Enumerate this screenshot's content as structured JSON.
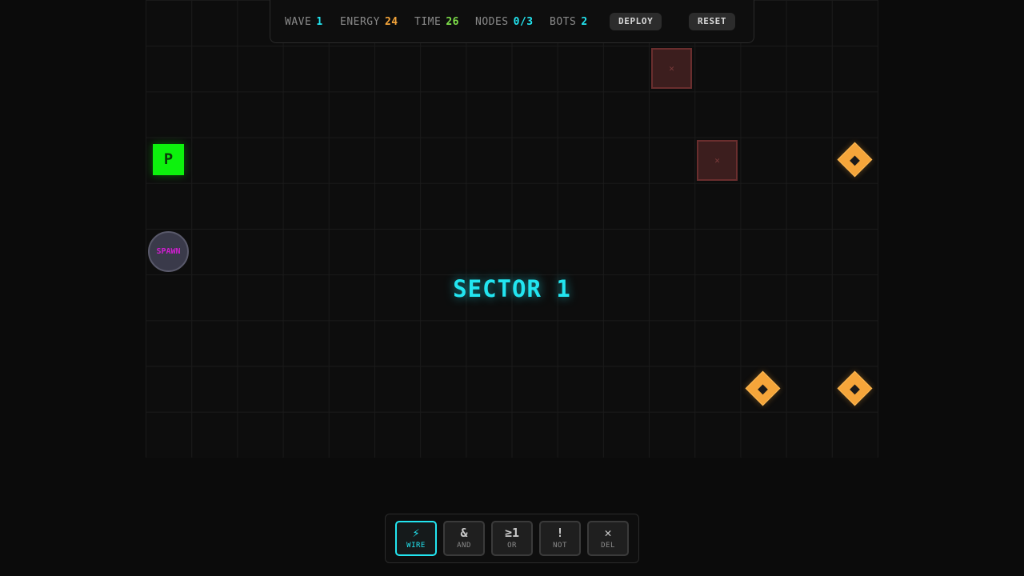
{
  "hud": {
    "wave": {
      "label": "WAVE",
      "value": "1",
      "color": "#22e5f0"
    },
    "energy": {
      "label": "ENERGY",
      "value": "24",
      "color": "#f5a53a"
    },
    "time": {
      "label": "TIME",
      "value": "26",
      "color": "#7ee04a"
    },
    "nodes": {
      "label": "NODES",
      "value": "0/3",
      "color": "#22e5f0"
    },
    "bots": {
      "label": "BOTS",
      "value": "2",
      "color": "#22e5f0"
    },
    "deploy_label": "DEPLOY",
    "reset_label": "RESET"
  },
  "board": {
    "player_label": "P",
    "spawn_label": "SPAWN",
    "blocked_mark": "✕",
    "banner": "SECTOR 1"
  },
  "toolbar": {
    "tools": [
      {
        "icon": "bolt-icon",
        "glyph": "⚡",
        "label": "WIRE",
        "active": true
      },
      {
        "icon": "ampersand-icon",
        "glyph": "&",
        "label": "AND",
        "active": false
      },
      {
        "icon": "ge-one-icon",
        "glyph": "≥1",
        "label": "OR",
        "active": false
      },
      {
        "icon": "exclamation-icon",
        "glyph": "!",
        "label": "NOT",
        "active": false
      },
      {
        "icon": "close-icon",
        "glyph": "✕",
        "label": "DEL",
        "active": false
      }
    ]
  },
  "colors": {
    "accent": "#22e5f0",
    "player": "#0df20d",
    "node": "#f5a53a",
    "spawn_text": "#d01ed0",
    "blocked": "#3c1e1e"
  }
}
